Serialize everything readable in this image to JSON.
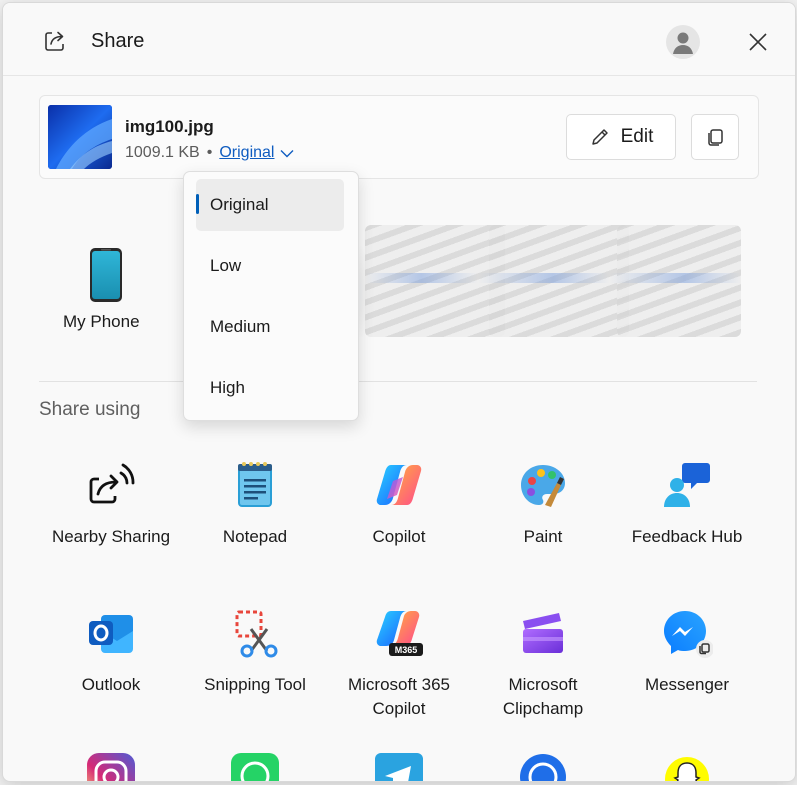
{
  "window": {
    "title": "Share"
  },
  "file": {
    "name": "img100.jpg",
    "size": "1009.1 KB",
    "separator": "•",
    "quality": "Original"
  },
  "actions": {
    "edit_label": "Edit"
  },
  "quality_menu": {
    "options": [
      "Original",
      "Low",
      "Medium",
      "High"
    ],
    "selected": "Original"
  },
  "devices": [
    {
      "label": "My Phone"
    }
  ],
  "share_using": {
    "heading": "Share using",
    "apps": [
      {
        "label": "Nearby Sharing",
        "icon": "nearby-sharing-icon"
      },
      {
        "label": "Notepad",
        "icon": "notepad-icon"
      },
      {
        "label": "Copilot",
        "icon": "copilot-icon"
      },
      {
        "label": "Paint",
        "icon": "paint-icon"
      },
      {
        "label": "Feedback Hub",
        "icon": "feedback-hub-icon"
      },
      {
        "label": "Outlook",
        "icon": "outlook-icon"
      },
      {
        "label": "Snipping Tool",
        "icon": "snipping-tool-icon"
      },
      {
        "label": "Microsoft 365 Copilot",
        "icon": "m365-copilot-icon",
        "badge": "M365"
      },
      {
        "label": "Microsoft Clipchamp",
        "icon": "clipchamp-icon"
      },
      {
        "label": "Messenger",
        "icon": "messenger-icon"
      },
      {
        "label": "",
        "icon": "instagram-icon"
      },
      {
        "label": "",
        "icon": "whatsapp-icon"
      },
      {
        "label": "",
        "icon": "telegram-icon"
      },
      {
        "label": "",
        "icon": "sync-app-icon"
      },
      {
        "label": "",
        "icon": "snapchat-icon"
      }
    ]
  },
  "colors": {
    "accent": "#005fb8",
    "link": "#0f5cc0"
  }
}
